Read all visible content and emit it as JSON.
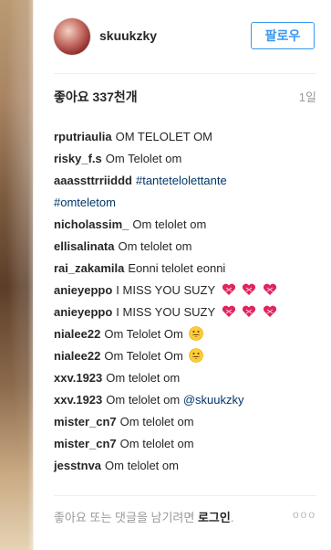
{
  "post": {
    "username": "skuukzky",
    "follow_label": "팔로우",
    "likes": "좋아요 337천개",
    "age": "1일"
  },
  "comments": [
    {
      "user": "rputriaulia",
      "text": "OM TELOLET OM"
    },
    {
      "user": "risky_f.s",
      "text": "Om Telolet om"
    },
    {
      "user": "aaassttrriiddd",
      "text": "#tantetelolettante",
      "text2": "#omteletom"
    },
    {
      "user": "nicholassim_",
      "text": "Om telolet om"
    },
    {
      "user": "ellisalinata",
      "text": "Om telolet om"
    },
    {
      "user": "rai_zakamila",
      "text": "Eonni telolet eonni"
    },
    {
      "user": "anieyeppo",
      "text": "I MISS YOU SUZY",
      "emoji": "heart-x3"
    },
    {
      "user": "anieyeppo",
      "text": "I MISS YOU SUZY",
      "emoji": "heart-x3"
    },
    {
      "user": "nialee22",
      "text": "Om Telolet Om",
      "emoji": "smile"
    },
    {
      "user": "nialee22",
      "text": "Om Telolet Om",
      "emoji": "smile"
    },
    {
      "user": "xxv.1923",
      "text": "Om telolet om"
    },
    {
      "user": "xxv.1923",
      "text": "Om telolet om",
      "mention": "@skuukzky"
    },
    {
      "user": "mister_cn7",
      "text": "Om telolet om"
    },
    {
      "user": "mister_cn7",
      "text": "Om telolet om"
    },
    {
      "user": "jesstnva",
      "text": "Om telolet om"
    }
  ],
  "footer": {
    "prompt": "좋아요 또는 댓글을 남기려면 ",
    "login": "로그인",
    "period": ".",
    "more": "ooo"
  },
  "colors": {
    "link": "#003569",
    "follow": "#3897f0",
    "muted": "#999999"
  }
}
